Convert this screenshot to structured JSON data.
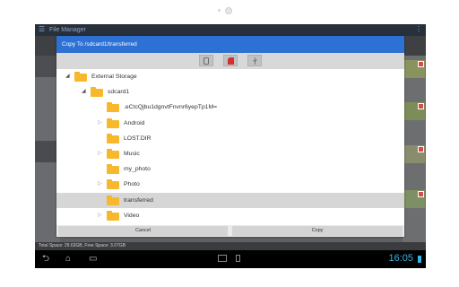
{
  "app_bar": {
    "title": "File Manager",
    "menu_icon": "hamburger-menu-icon",
    "overflow_icon": "overflow-menu-icon"
  },
  "dialog": {
    "title": "Copy To /sdcard1/transferred",
    "storage_buttons": [
      {
        "icon": "phone-storage-icon"
      },
      {
        "icon": "sd-card-icon"
      },
      {
        "icon": "usb-icon"
      }
    ],
    "tree": [
      {
        "name": "External Storage",
        "expanded": true,
        "has_children": true,
        "selected": false
      },
      {
        "name": "sdcard1",
        "expanded": true,
        "has_children": true,
        "selected": false
      },
      {
        "name": ".eCtcQjbu1dgnvtFnvnr6yepTp1M=",
        "expanded": false,
        "has_children": false,
        "selected": false
      },
      {
        "name": "Android",
        "expanded": false,
        "has_children": true,
        "selected": false
      },
      {
        "name": "LOST.DIR",
        "expanded": false,
        "has_children": false,
        "selected": false
      },
      {
        "name": "Music",
        "expanded": false,
        "has_children": true,
        "selected": false
      },
      {
        "name": "my_photo",
        "expanded": false,
        "has_children": false,
        "selected": false
      },
      {
        "name": "Photo",
        "expanded": false,
        "has_children": true,
        "selected": false
      },
      {
        "name": "transferred",
        "expanded": false,
        "has_children": false,
        "selected": true
      },
      {
        "name": "Video",
        "expanded": false,
        "has_children": true,
        "selected": false
      }
    ],
    "cancel_label": "Cancel",
    "copy_label": "Copy"
  },
  "status": {
    "space_text": "Total Space: 29.63GB, Free Space: 3.07GB"
  },
  "navbar": {
    "clock": "16:05",
    "back_icon": "back-icon",
    "home_icon": "home-icon",
    "recents_icon": "recent-apps-icon"
  },
  "colors": {
    "accent": "#2c71d3",
    "folder": "#f7b92b",
    "clock": "#33b5e5",
    "selected_row": "#d6d6d6"
  }
}
